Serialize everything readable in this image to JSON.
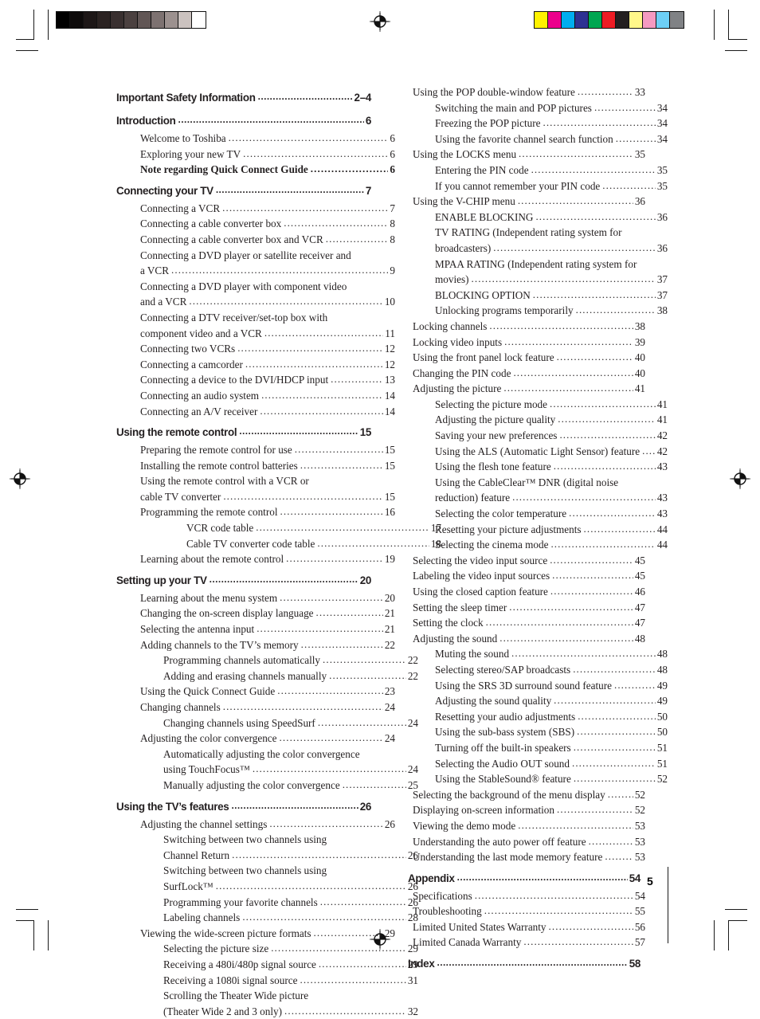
{
  "document": {
    "folio": "5",
    "page_kind": "table-of-contents"
  },
  "prepress": {
    "grayscale_wedge": [
      "#000000",
      "#0d0a0a",
      "#1d1717",
      "#2b2322",
      "#393030",
      "#4b4140",
      "#615655",
      "#7d7271",
      "#9c918f",
      "#cbc2bf",
      "#ffffff"
    ],
    "color_bar": [
      "#fff200",
      "#ec008c",
      "#00aeef",
      "#2e3192",
      "#00a651",
      "#ed1c24",
      "#231f20",
      "#fff78a",
      "#f49ac1",
      "#6dcff6",
      "#808285"
    ],
    "registration_icon": "registration-target-icon"
  },
  "toc": {
    "left_column": [
      {
        "level": 0,
        "title": "Important Safety Information",
        "page": "2–4"
      },
      {
        "level": 0,
        "title": "Introduction",
        "page": "6"
      },
      {
        "level": 1,
        "title": "Welcome to Toshiba",
        "page": "6"
      },
      {
        "level": 1,
        "title": "Exploring your new TV",
        "page": "6"
      },
      {
        "level": 1,
        "title": "Note regarding Quick Connect Guide",
        "page": "6",
        "bold": true
      },
      {
        "level": 0,
        "title": "Connecting your TV",
        "page": "7"
      },
      {
        "level": 1,
        "title": "Connecting a VCR",
        "page": "7"
      },
      {
        "level": 1,
        "title": "Connecting a cable converter box",
        "page": "8"
      },
      {
        "level": 1,
        "title": "Connecting a cable converter box and VCR",
        "page": "8"
      },
      {
        "level": 1,
        "first_line": "Connecting a DVD player or satellite receiver and",
        "title": "a VCR",
        "page": "9"
      },
      {
        "level": 1,
        "first_line": "Connecting a DVD player with component video",
        "title": "and a VCR",
        "page": "10"
      },
      {
        "level": 1,
        "first_line": "Connecting a DTV receiver/set-top box with",
        "title": "component video and a VCR",
        "page": "11"
      },
      {
        "level": 1,
        "title": "Connecting two VCRs",
        "page": "12"
      },
      {
        "level": 1,
        "title": "Connecting a camcorder",
        "page": "12"
      },
      {
        "level": 1,
        "title": "Connecting a device to the DVI/HDCP input",
        "page": "13"
      },
      {
        "level": 1,
        "title": "Connecting an audio system",
        "page": "14"
      },
      {
        "level": 1,
        "title": "Connecting an A/V receiver",
        "page": "14"
      },
      {
        "level": 0,
        "title": "Using the remote control",
        "page": "15"
      },
      {
        "level": 1,
        "title": "Preparing the remote control for use",
        "page": "15"
      },
      {
        "level": 1,
        "title": "Installing the remote control batteries",
        "page": "15"
      },
      {
        "level": 1,
        "first_line": "Using the remote control with a VCR or",
        "title": "cable TV converter",
        "page": "15"
      },
      {
        "level": 1,
        "title": "Programming the remote control",
        "page": "16"
      },
      {
        "level": 3,
        "title": "VCR code table",
        "page": "17"
      },
      {
        "level": 3,
        "title": "Cable TV converter code table",
        "page": "18"
      },
      {
        "level": 1,
        "title": "Learning about the remote control",
        "page": "19"
      },
      {
        "level": 0,
        "title": "Setting up your TV",
        "page": "20"
      },
      {
        "level": 1,
        "title": "Learning about the menu system",
        "page": "20"
      },
      {
        "level": 1,
        "title": "Changing the on-screen display language",
        "page": "21"
      },
      {
        "level": 1,
        "title": "Selecting the antenna input",
        "page": "21"
      },
      {
        "level": 1,
        "title": "Adding channels to the TV’s memory",
        "page": "22"
      },
      {
        "level": 2,
        "title": "Programming channels automatically",
        "page": "22"
      },
      {
        "level": 2,
        "title": "Adding and erasing channels manually",
        "page": "22"
      },
      {
        "level": 1,
        "title": "Using the Quick Connect Guide",
        "page": "23"
      },
      {
        "level": 1,
        "title": "Changing channels",
        "page": "24"
      },
      {
        "level": 2,
        "title": "Changing channels using SpeedSurf",
        "page": "24"
      },
      {
        "level": 1,
        "title": "Adjusting the color convergence",
        "page": "24"
      },
      {
        "level": 2,
        "first_line": "Automatically adjusting the color convergence",
        "title": "using TouchFocus™",
        "page": "24",
        "tm": "™"
      },
      {
        "level": 2,
        "title": "Manually adjusting the color convergence",
        "page": "25"
      },
      {
        "level": 0,
        "title": "Using the TV’s features",
        "page": "26"
      },
      {
        "level": 1,
        "title": "Adjusting the channel settings",
        "page": "26"
      },
      {
        "level": 2,
        "first_line": "Switching between two channels using",
        "title": "Channel Return",
        "page": "26"
      },
      {
        "level": 2,
        "first_line": "Switching between two channels using",
        "title": "SurfLock™",
        "page": "26"
      },
      {
        "level": 2,
        "title": "Programming your favorite channels",
        "page": "26"
      },
      {
        "level": 2,
        "title": "Labeling channels",
        "page": "28"
      },
      {
        "level": 1,
        "title": "Viewing the wide-screen picture formats",
        "page": "29"
      },
      {
        "level": 2,
        "title": "Selecting the picture size",
        "page": "29"
      },
      {
        "level": 2,
        "title": "Receiving a 480i/480p signal source",
        "page": "29"
      },
      {
        "level": 2,
        "title": "Receiving a 1080i signal source",
        "page": "31"
      },
      {
        "level": 2,
        "first_line": "Scrolling the Theater Wide picture",
        "title": "(Theater Wide 2 and 3 only)",
        "page": "32"
      }
    ],
    "right_column": [
      {
        "level": 1,
        "title": "Using the POP double-window feature",
        "page": "33"
      },
      {
        "level": 2,
        "title": "Switching the main and POP pictures",
        "page": "34"
      },
      {
        "level": 2,
        "title": "Freezing the POP picture",
        "page": "34"
      },
      {
        "level": 2,
        "title": "Using the favorite channel search function",
        "page": "34"
      },
      {
        "level": 1,
        "title": "Using the LOCKS menu",
        "page": "35"
      },
      {
        "level": 2,
        "title": "Entering the PIN code",
        "page": "35"
      },
      {
        "level": 2,
        "title": "If you cannot remember your PIN code",
        "page": "35"
      },
      {
        "level": 1,
        "title": "Using the V-CHIP menu",
        "page": "36"
      },
      {
        "level": 2,
        "title": "ENABLE BLOCKING",
        "page": "36"
      },
      {
        "level": 2,
        "first_line": "TV RATING (Independent rating system for",
        "title": "broadcasters)",
        "page": "36"
      },
      {
        "level": 2,
        "first_line": "MPAA RATING (Independent rating system for",
        "title": "movies)",
        "page": "37"
      },
      {
        "level": 2,
        "title": "BLOCKING OPTION",
        "page": "37"
      },
      {
        "level": 2,
        "title": "Unlocking programs temporarily",
        "page": "38"
      },
      {
        "level": 1,
        "title": "Locking channels",
        "page": "38"
      },
      {
        "level": 1,
        "title": "Locking video inputs",
        "page": "39"
      },
      {
        "level": 1,
        "title": "Using the front panel lock feature",
        "page": "40"
      },
      {
        "level": 1,
        "title": "Changing the PIN code",
        "page": "40"
      },
      {
        "level": 1,
        "title": "Adjusting the picture",
        "page": "41"
      },
      {
        "level": 2,
        "title": "Selecting the picture mode",
        "page": "41"
      },
      {
        "level": 2,
        "title": "Adjusting the picture quality",
        "page": "41"
      },
      {
        "level": 2,
        "title": "Saving your new preferences",
        "page": "42"
      },
      {
        "level": 2,
        "title": "Using the ALS (Automatic Light Sensor) feature",
        "page": "42"
      },
      {
        "level": 2,
        "title": "Using the flesh tone feature",
        "page": "43"
      },
      {
        "level": 2,
        "first_line": "Using the CableClear™ DNR (digital noise",
        "title": "reduction) feature",
        "page": "43"
      },
      {
        "level": 2,
        "title": "Selecting the color temperature",
        "page": "43"
      },
      {
        "level": 2,
        "title": "Resetting your picture adjustments",
        "page": "44"
      },
      {
        "level": 2,
        "title": "Selecting the cinema mode",
        "page": "44"
      },
      {
        "level": 1,
        "title": "Selecting the video input source",
        "page": "45"
      },
      {
        "level": 1,
        "title": "Labeling the video input sources",
        "page": "45"
      },
      {
        "level": 1,
        "title": "Using the closed caption feature",
        "page": "46"
      },
      {
        "level": 1,
        "title": "Setting the sleep timer",
        "page": "47"
      },
      {
        "level": 1,
        "title": "Setting the clock",
        "page": "47"
      },
      {
        "level": 1,
        "title": "Adjusting the sound",
        "page": "48"
      },
      {
        "level": 2,
        "title": "Muting the sound",
        "page": "48"
      },
      {
        "level": 2,
        "title": "Selecting stereo/SAP broadcasts",
        "page": "48"
      },
      {
        "level": 2,
        "title": "Using the SRS 3D surround sound feature",
        "page": "49"
      },
      {
        "level": 2,
        "title": "Adjusting the sound quality",
        "page": "49"
      },
      {
        "level": 2,
        "title": "Resetting your audio adjustments",
        "page": "50"
      },
      {
        "level": 2,
        "title": "Using the sub-bass system (SBS)",
        "page": "50"
      },
      {
        "level": 2,
        "title": "Turning off the built-in speakers",
        "page": "51"
      },
      {
        "level": 2,
        "title": "Selecting the Audio OUT sound",
        "page": "51"
      },
      {
        "level": 2,
        "title": "Using the StableSound® feature",
        "page": "52"
      },
      {
        "level": 1,
        "title": "Selecting the background of the menu display",
        "page": "52"
      },
      {
        "level": 1,
        "title": "Displaying on-screen information",
        "page": "52"
      },
      {
        "level": 1,
        "title": "Viewing the demo mode",
        "page": "53"
      },
      {
        "level": 1,
        "title": "Understanding the auto power off feature",
        "page": "53"
      },
      {
        "level": 1,
        "title": "Understanding the last mode memory feature",
        "page": "53"
      },
      {
        "level": 0,
        "title": "Appendix",
        "page": "54"
      },
      {
        "level": 1,
        "title": "Specifications",
        "page": "54"
      },
      {
        "level": 1,
        "title": "Troubleshooting",
        "page": "55"
      },
      {
        "level": 1,
        "title": "Limited United States Warranty",
        "page": "56"
      },
      {
        "level": 1,
        "title": "Limited Canada Warranty",
        "page": "57"
      },
      {
        "level": 0,
        "title": "Index",
        "page": "58"
      }
    ]
  }
}
